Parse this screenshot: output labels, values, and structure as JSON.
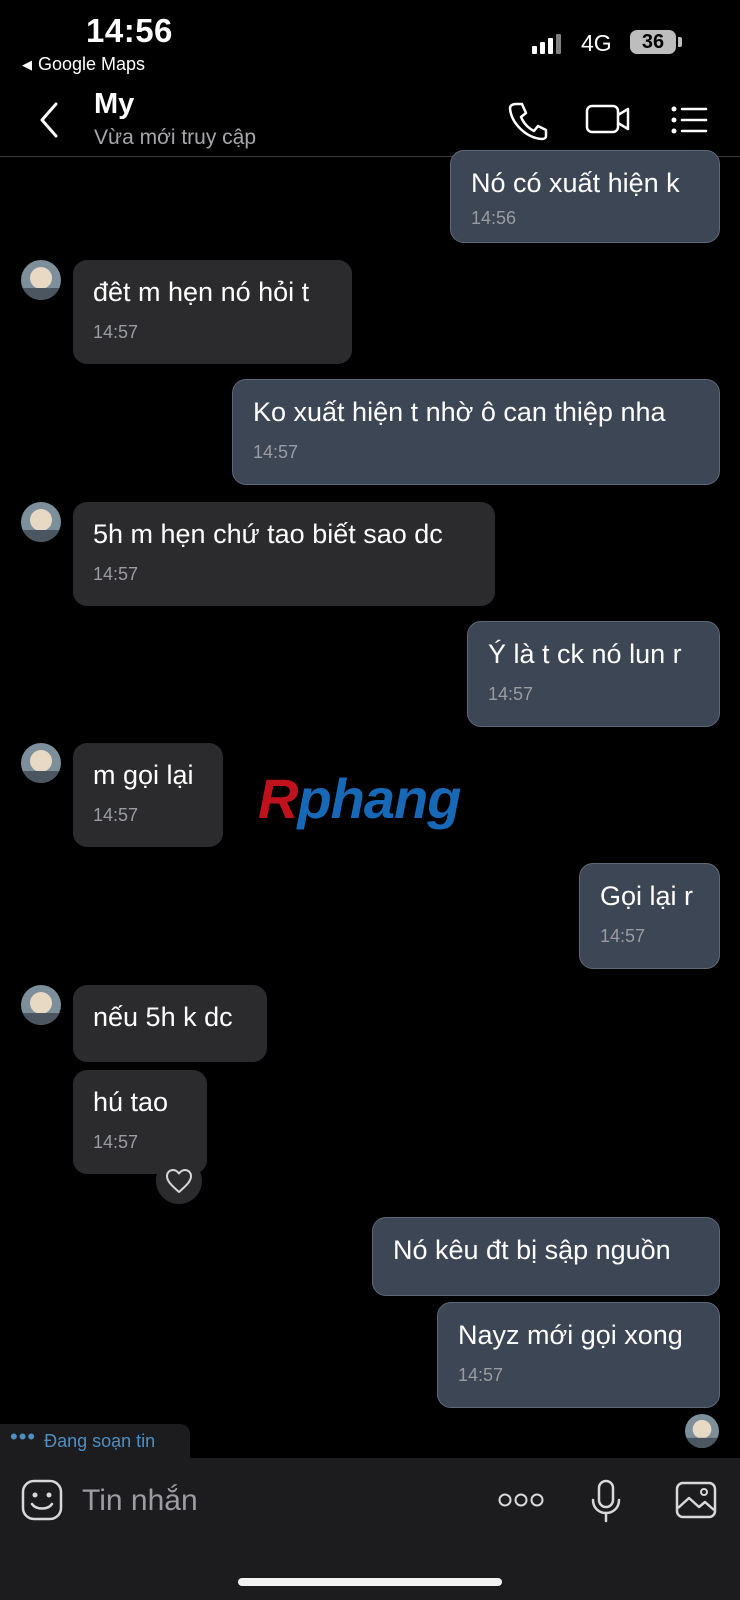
{
  "status_bar": {
    "time": "14:56",
    "back_app": "Google Maps",
    "network": "4G",
    "battery": "36"
  },
  "header": {
    "contact_name": "My",
    "contact_status": "Vừa mới truy cập",
    "icons": [
      "back-icon",
      "phone-icon",
      "video-icon",
      "menu-icon"
    ]
  },
  "messages": [
    {
      "dir": "out",
      "text": "Nó có xuất hiện k",
      "time": "14:56"
    },
    {
      "dir": "in",
      "text": "đêt m hẹn nó hỏi t",
      "time": "14:57"
    },
    {
      "dir": "out",
      "text": "Ko xuất hiện t nhờ ô can thiệp nha",
      "time": "14:57"
    },
    {
      "dir": "in",
      "text": "5h m hẹn chứ tao biết sao dc",
      "time": "14:57"
    },
    {
      "dir": "out",
      "text": "Ý là t ck nó lun r",
      "time": "14:57"
    },
    {
      "dir": "in",
      "text": "m gọi lại",
      "time": "14:57"
    },
    {
      "dir": "out",
      "text": "Gọi lại r",
      "time": "14:57"
    },
    {
      "dir": "in",
      "text": "nếu 5h k dc",
      "time": ""
    },
    {
      "dir": "in",
      "text": "hú tao",
      "time": "14:57",
      "reaction": "heart-icon"
    },
    {
      "dir": "out",
      "text": "Nó kêu đt bị sập nguồn",
      "time": ""
    },
    {
      "dir": "out",
      "text": "Nayz mới gọi xong",
      "time": "14:57"
    }
  ],
  "watermark": {
    "first": "R",
    "rest": "phang"
  },
  "typing_indicator": "Đang soạn tin",
  "input": {
    "placeholder": "Tin nhắn",
    "icons": [
      "emoji-icon",
      "more-icon",
      "microphone-icon",
      "image-icon"
    ]
  },
  "colors": {
    "background": "#000000",
    "incoming_bubble": "#2b2b2d",
    "outgoing_bubble": "#3d4655",
    "typing_text": "#4e8fc1"
  }
}
